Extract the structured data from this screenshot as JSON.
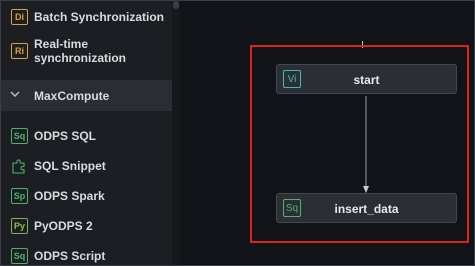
{
  "sidebar": {
    "items": [
      {
        "icon": "Di",
        "icon_name": "batch-sync-icon",
        "label": "Batch Synchronization"
      },
      {
        "icon": "Ri",
        "icon_name": "realtime-sync-icon",
        "label": "Real-time synchronization"
      }
    ],
    "group": {
      "label": "MaxCompute",
      "icon_name": "chevron-down-icon"
    },
    "group_items": [
      {
        "icon": "Sq",
        "icon_name": "odps-sql-icon",
        "label": "ODPS SQL"
      },
      {
        "icon": "",
        "icon_name": "puzzle-piece-icon",
        "label": "SQL Snippet"
      },
      {
        "icon": "Sp",
        "icon_name": "odps-spark-icon",
        "label": "ODPS Spark"
      },
      {
        "icon": "Py",
        "icon_name": "pyodps-icon",
        "label": "PyODPS 2"
      },
      {
        "icon": "Sq",
        "icon_name": "odps-script-icon",
        "label": "ODPS Script"
      }
    ]
  },
  "canvas": {
    "nodes": [
      {
        "icon": "Vi",
        "label": "start"
      },
      {
        "icon": "Sq",
        "label": "insert_data"
      }
    ]
  },
  "colors": {
    "highlight_border": "#e0201c",
    "sidebar_bg": "#1c1e23",
    "canvas_bg": "#111318"
  }
}
